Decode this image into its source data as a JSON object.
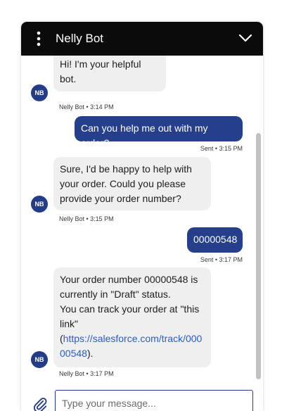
{
  "header": {
    "title": "Nelly Bot",
    "menu_icon": "vertical-dots-icon",
    "collapse_icon": "chevron-down-icon"
  },
  "bot": {
    "avatar_initials": "NB"
  },
  "messages": [
    {
      "sender": "bot",
      "text": "Hi! I'm your helpful bot.",
      "meta": "Nelly Bot • 3:14 PM"
    },
    {
      "sender": "user",
      "text": "Can you help me out with my order?",
      "meta": "Sent • 3:15 PM"
    },
    {
      "sender": "bot",
      "lines": [
        "Sure, I'd be happy to help with",
        "your order. Could you please",
        "provide your order number?"
      ],
      "meta": "Nelly Bot • 3:15 PM"
    },
    {
      "sender": "user",
      "text": "00000548",
      "meta": "Sent • 3:17 PM"
    },
    {
      "sender": "bot",
      "lines": [
        "Your order number 00000548 is",
        "currently in \"Draft\" status.",
        "You can track your order at \"this",
        "link\""
      ],
      "link_prefix": "(",
      "link_line1": "https://salesforce.com/track/000",
      "link_line2": "00548",
      "link_suffix": ").",
      "meta": "Nelly Bot • 3:17 PM"
    }
  ],
  "composer": {
    "placeholder": "Type your message...",
    "value": "",
    "attach_icon": "paperclip-icon"
  },
  "colors": {
    "header_bg": "#0b0b0b",
    "user_bubble": "#253f8a",
    "bot_bubble": "#efefef",
    "avatar_bg": "#233c87",
    "link": "#2a5ec1"
  }
}
